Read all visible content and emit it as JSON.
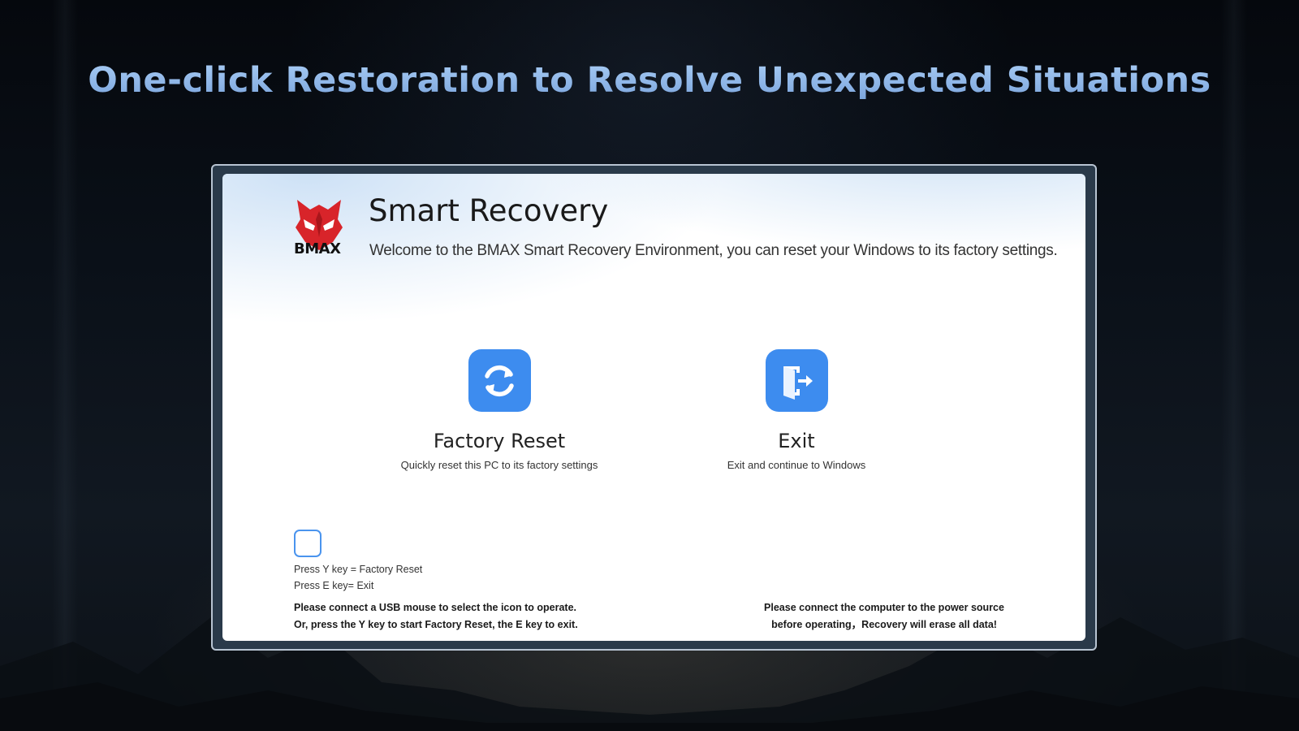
{
  "headline": "One-click Restoration to Resolve Unexpected Situations",
  "app": {
    "brand": "BMAX",
    "title": "Smart Recovery",
    "subtitle": "Welcome to the BMAX Smart Recovery Environment, you can reset your Windows to its factory settings."
  },
  "actions": [
    {
      "icon": "refresh-icon",
      "label": "Factory Reset",
      "description": "Quickly reset this PC to its factory settings"
    },
    {
      "icon": "exit-door-icon",
      "label": "Exit",
      "description": "Exit and continue to Windows"
    }
  ],
  "hints": {
    "y_key": "Press  Y key = Factory Reset",
    "e_key": "Press  E key= Exit"
  },
  "notes": {
    "left_line1": "Please connect a USB mouse to select the icon to operate.",
    "left_line2": "Or, press the Y key to start Factory Reset, the E key to exit.",
    "right_line1": "Please connect the computer to the power source",
    "right_line2": "before operating，Recovery will erase all data!"
  },
  "colors": {
    "headline": "#8fb7e8",
    "accent_blue": "#3d8cef",
    "logo_red": "#d8242a"
  }
}
